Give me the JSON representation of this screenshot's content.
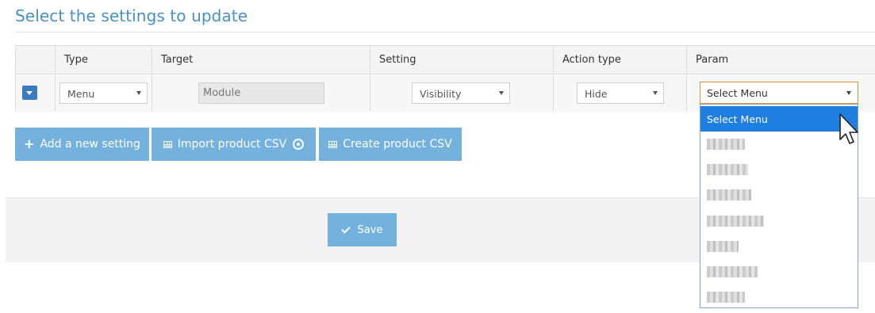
{
  "page": {
    "title": "Select the settings to update"
  },
  "grid": {
    "columns": [
      "",
      "Type",
      "Target",
      "Setting",
      "Action type",
      "Param"
    ],
    "row": {
      "type_value": "Menu",
      "target_value": "Module",
      "setting_value": "Visibility",
      "action_value": "Hide",
      "param_value": "Select Menu"
    }
  },
  "buttons": {
    "add_setting": "Add a new setting",
    "import_csv": "Import product CSV",
    "create_csv": "Create product CSV",
    "save": "Save"
  },
  "param_dropdown": {
    "options": [
      "Select Menu"
    ],
    "selected": "Select Menu"
  },
  "colors": {
    "title": "#4a90c2",
    "button": "#74b2dd",
    "dropdown_highlight": "#1e7fe0",
    "focus_border": "#e0903a"
  }
}
